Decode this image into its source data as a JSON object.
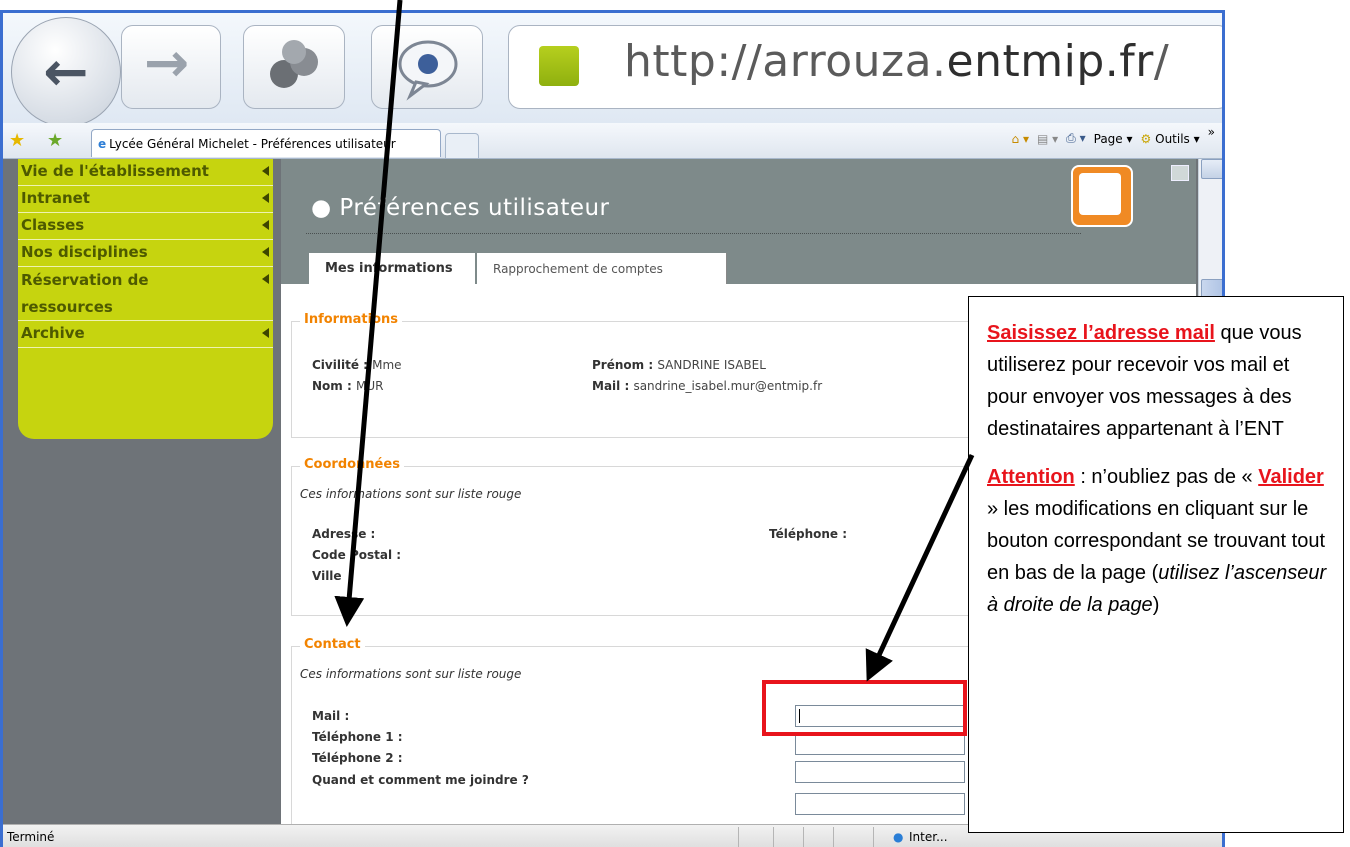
{
  "browser": {
    "url_prefix": "http://arrouza.",
    "url_domain": "entmip.fr",
    "url_suffix": "/",
    "tab_title": "Lycée Général Michelet - Préférences utilisateur",
    "command_bar": {
      "page_label": "Page",
      "tools_label": "Outils",
      "more": "»"
    },
    "status_text": "Terminé",
    "zone_text": "Inter..."
  },
  "sidebar": {
    "items": [
      {
        "label": "Vie de l'établissement"
      },
      {
        "label": "Intranet"
      },
      {
        "label": "Classes"
      },
      {
        "label": "Nos disciplines"
      },
      {
        "label": "Réservation de ressources"
      },
      {
        "label": "Archive"
      }
    ]
  },
  "header": {
    "title": "Préférences utilisateur",
    "tabs": [
      {
        "label": "Mes informations"
      },
      {
        "label": "Rapprochement de comptes"
      }
    ]
  },
  "informations": {
    "legend": "Informations",
    "civilite_label": "Civilité :",
    "civilite_value": "Mme",
    "nom_label": "Nom :",
    "nom_value": "MUR",
    "prenom_label": "Prénom :",
    "prenom_value": "SANDRINE ISABEL",
    "mail_label": "Mail :",
    "mail_value": "sandrine_isabel.mur@entmip.fr"
  },
  "coordonnees": {
    "legend": "Coordonnées",
    "note": "Ces informations sont sur liste rouge",
    "adresse_label": "Adresse :",
    "code_postal_label": "Code Postal :",
    "ville_label": "Ville",
    "telephone_label": "Téléphone :"
  },
  "contact": {
    "legend": "Contact",
    "note": "Ces informations sont sur liste rouge",
    "mail_label": "Mail :",
    "tel1_label": "Téléphone 1 :",
    "tel2_label": "Téléphone 2 :",
    "joindre_label": "Quand et comment me joindre ?"
  },
  "callout": {
    "p1_red": "Saisissez l’adresse mail",
    "p1_rest": " que vous utiliserez pour recevoir vos mail et pour envoyer vos messages à des destinataires appartenant à l’ENT",
    "p2_red": "Attention",
    "p2_a": " : n’oubliez pas de « ",
    "p2_red2": "Valider",
    "p2_b": " » les modifications en cliquant sur le bouton correspondant se trouvant tout en bas de la page (",
    "p2_italic": "utilisez l’ascenseur  à droite de la page",
    "p2_end": ")"
  }
}
